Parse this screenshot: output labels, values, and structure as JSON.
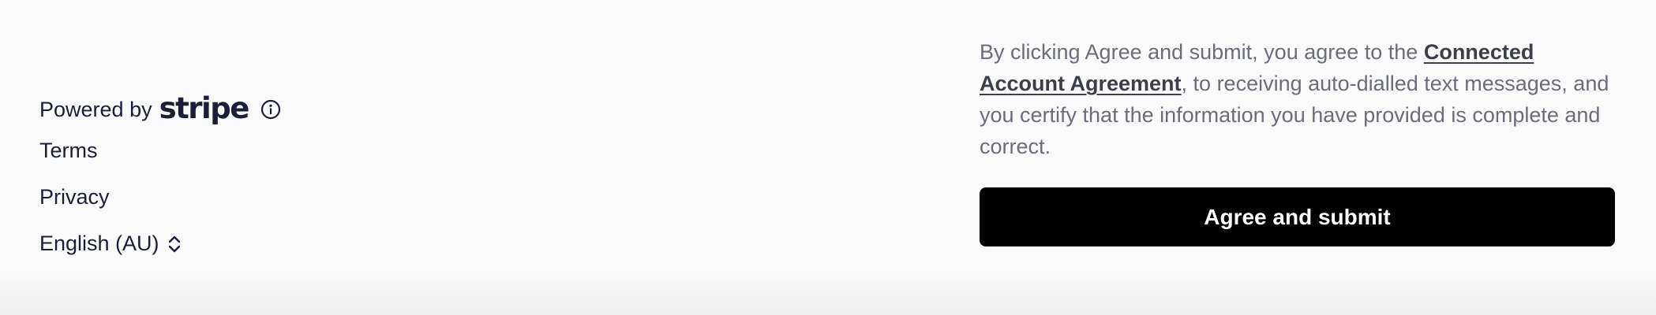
{
  "footer": {
    "powered_by": "Powered by",
    "brand": "stripe",
    "icons": {
      "info": "info-circle-icon",
      "language_toggle": "chevron-up-down-icon"
    },
    "terms": "Terms",
    "privacy": "Privacy",
    "language": "English (AU)"
  },
  "consent": {
    "text_before": "By clicking Agree and submit, you agree to the ",
    "agreement_link": "Connected Account Agreement",
    "text_after": ", to receiving auto-dialled text messages, and you certify that the information you have provided is complete and correct.",
    "submit_label": "Agree and submit"
  },
  "colors": {
    "button_bg": "#000000",
    "button_text": "#ffffff",
    "body_text": "#6b6e7a",
    "link_text": "#3c3f4a",
    "footer_text": "#1a1f36",
    "page_bg": "#fafafa"
  }
}
